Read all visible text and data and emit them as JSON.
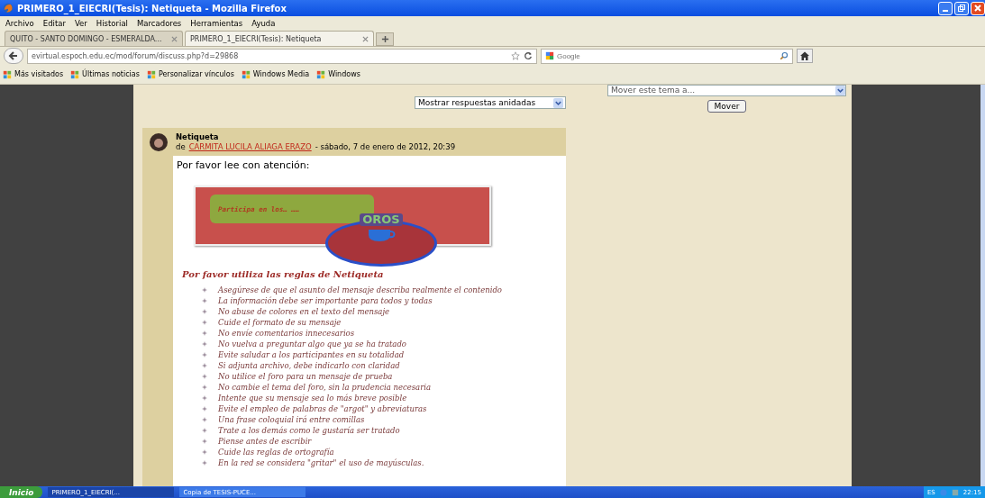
{
  "window": {
    "title": "PRIMERO_1_EIECRI(Tesis): Netiqueta - Mozilla Firefox"
  },
  "menu": [
    "Archivo",
    "Editar",
    "Ver",
    "Historial",
    "Marcadores",
    "Herramientas",
    "Ayuda"
  ],
  "tabs": [
    {
      "label": "QUITO - SANTO DOMINGO - ESMERALDA...",
      "selected": false
    },
    {
      "label": "PRIMERO_1_EIECRI(Tesis): Netiqueta",
      "selected": true
    }
  ],
  "address": {
    "value": "evirtual.espoch.edu.ec/mod/forum/discuss.php?d=29868"
  },
  "search": {
    "placeholder": "Google"
  },
  "bookmarks": [
    "Más visitados",
    "Últimas noticias",
    "Personalizar vínculos",
    "Windows Media",
    "Windows"
  ],
  "page": {
    "display_select": "Mostrar respuestas anidadas",
    "move_select": "Mover este tema a...",
    "move_button": "Mover",
    "post": {
      "title": "Netiqueta",
      "by": "de",
      "author": "CARMITA LUCILA ALIAGA ERAZO",
      "date": "- sábado, 7 de enero de 2012, 20:39",
      "intro": "Por favor lee con atención:",
      "banner_text": "Participa en los… ……",
      "banner_logo": "OROS",
      "heading": "Por favor utiliza  las reglas de Netiqueta",
      "rules": [
        "Asegúrese de que el asunto del mensaje describa realmente el contenido",
        "La información debe ser importante para todos y todas",
        "No abuse de colores en el texto del mensaje",
        "Cuide el formato de su mensaje",
        "No envíe comentarios innecesarios",
        "No vuelva a preguntar algo que ya se ha tratado",
        "Evite saludar a los participantes en su totalidad",
        "Si adjunta archivo, debe indicarlo con claridad",
        "No utilice el foro para un mensaje de prueba",
        "No cambie el tema del foro, sin la prudencia necesaria",
        "Intente que su mensaje sea lo más breve posible",
        "Evite el empleo de palabras de \"argot\" y abreviaturas",
        "Una frase coloquial irá entre comillas",
        "Trate a los demás como le gustaría ser tratado",
        "Piense antes de escribir",
        "Cuide las reglas de ortografía",
        "En la red se considera \"gritar\" el uso de mayúsculas."
      ]
    }
  },
  "taskbar": {
    "start": "Inicio",
    "tasks": [
      {
        "label": "PRIMERO_1_EIECRI(...",
        "selected": true
      },
      {
        "label": "Copia de TESIS-PUCE...",
        "selected": false
      }
    ],
    "language": "ES",
    "clock": "22:15"
  }
}
